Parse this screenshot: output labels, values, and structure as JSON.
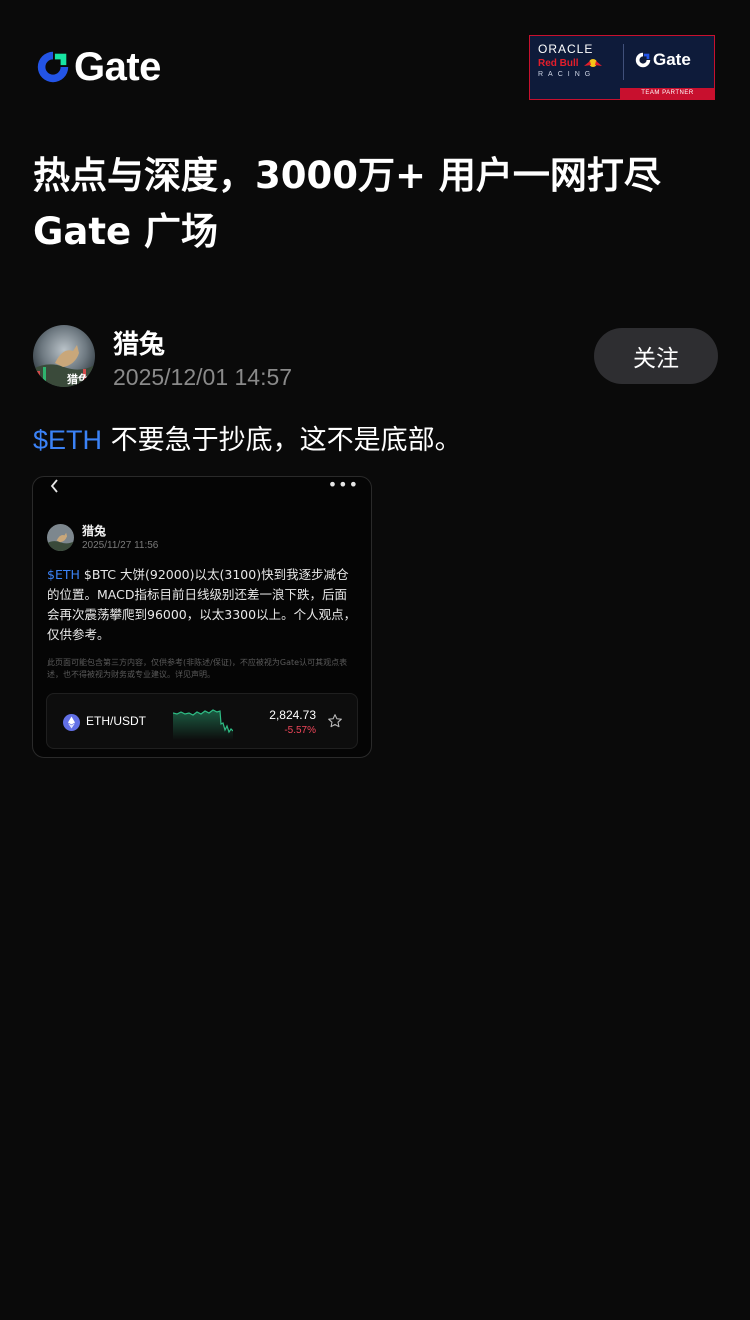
{
  "brand": {
    "logo_text": "Gate",
    "accent_color": "#2354e6",
    "partner": {
      "oracle": "ORACLE",
      "redbull": "Red Bull",
      "racing": "RACING",
      "gate": "Gate",
      "team_partner": "TEAM PARTNER"
    }
  },
  "headline": {
    "line1": "热点与深度，3000万+ 用户一网打尽",
    "line2": "Gate 广场"
  },
  "author": {
    "name": "猎兔",
    "date": "2025/12/01 14:57",
    "avatar_label": "猎兔",
    "follow_label": "关注"
  },
  "post": {
    "tag": "$ETH",
    "text": " 不要急于抄底，这不是底部。"
  },
  "card": {
    "back_icon": "chevron-left-icon",
    "more_icon": "more-icon",
    "author_name": "猎兔",
    "author_date": "2025/11/27 11:56",
    "tag": "$ETH",
    "body": " $BTC 大饼(92000)以太(3100)快到我逐步减仓的位置。MACD指标目前日线级别还差一浪下跌，后面会再次震荡攀爬到96000，以太3300以上。个人观点，仅供参考。",
    "disclaimer": "此页面可能包含第三方内容，仅供参考(非陈述/保证)，不应被视为Gate认可其观点表述，也不得被视为财务或专业建议。详见声明。",
    "ticker": {
      "pair": "ETH/USDT",
      "price": "2,824.73",
      "change": "-5.57%",
      "change_color": "#f0465a",
      "spark_color": "#2ebd85"
    }
  }
}
